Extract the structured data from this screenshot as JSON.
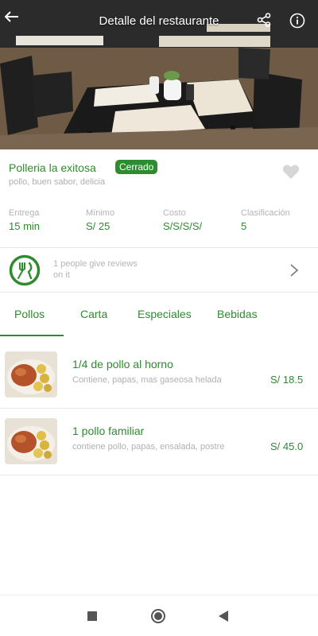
{
  "header": {
    "title": "Detalle del restaurante",
    "back_icon": "arrow-left-icon",
    "share_icon": "share-icon",
    "info_icon": "info-icon"
  },
  "restaurant": {
    "name": "Polleria la exitosa",
    "status": "Cerrado",
    "tagline": "pollo, buen sabor, delicia",
    "favorite_icon": "heart-icon",
    "stats": [
      {
        "label": "Entrega",
        "value": "15 min"
      },
      {
        "label": "Mínimo",
        "value": "S/ 25"
      },
      {
        "label": "Costo",
        "value": "S/S/S/S/"
      },
      {
        "label": "Clasificación",
        "value": "5"
      }
    ]
  },
  "reviews": {
    "icon": "utensils-icon",
    "text": "1 people give reviews on it"
  },
  "tabs": [
    "Pollos",
    "Carta",
    "Especiales",
    "Bebidas"
  ],
  "active_tab": "Pollos",
  "menu_items": [
    {
      "name": "1/4 de pollo al horno",
      "description": "Contiene, papas, mas gaseosa helada",
      "price": "S/ 18.5"
    },
    {
      "name": "1 pollo familiar",
      "description": "contiene pollo, papas, ensalada, postre",
      "price": "S/ 45.0"
    }
  ],
  "colors": {
    "accent": "#2e8b2e",
    "muted_text": "#b0b0b0"
  }
}
